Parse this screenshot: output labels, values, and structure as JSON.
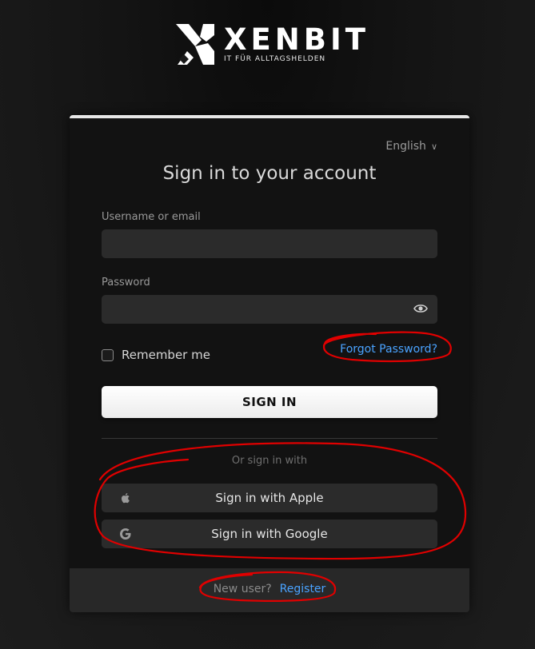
{
  "brand": {
    "name": "XENBIT",
    "tagline": "IT FÜR ALLTAGSHELDEN"
  },
  "language": {
    "selected": "English",
    "icon": "chevron-down-icon"
  },
  "form": {
    "title": "Sign in to your account",
    "username_label": "Username or email",
    "username_value": "",
    "password_label": "Password",
    "password_value": "",
    "remember_label": "Remember me",
    "remember_checked": false,
    "forgot_label": "Forgot Password?",
    "submit_label": "SIGN IN"
  },
  "social": {
    "or_text": "Or sign in with",
    "apple_label": "Sign in with Apple",
    "google_label": "Sign in with Google"
  },
  "footer": {
    "new_user_text": "New user?",
    "register_label": "Register"
  },
  "colors": {
    "link": "#4aa3ff",
    "annotation": "#e00000",
    "card_bg": "#121212",
    "field_bg": "#2b2b2b"
  }
}
